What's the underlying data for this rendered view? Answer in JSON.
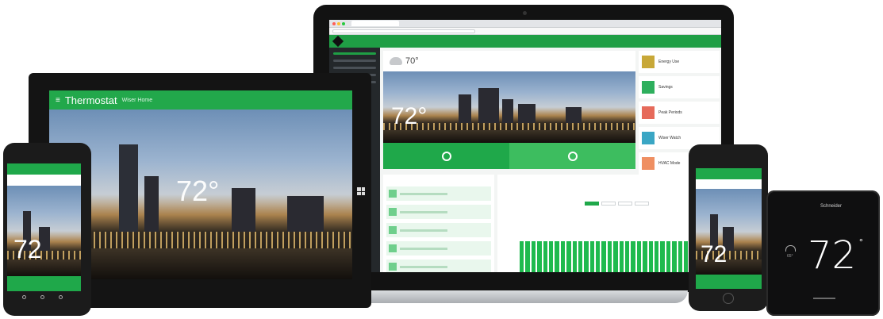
{
  "laptop": {
    "hero_temp": "72°",
    "hero_header_temp": "70°",
    "cards": [
      {
        "title": "Energy Use",
        "color": "#c8a838"
      },
      {
        "title": "Savings",
        "color": "#2eaf5d"
      },
      {
        "title": "Peak Periods",
        "color": "#e66a5a"
      },
      {
        "title": "Wiser Watch",
        "color": "#3aa6c4"
      },
      {
        "title": "HVAC Mode",
        "color": "#ef8f62"
      }
    ],
    "chart": {
      "bar_count": 33
    }
  },
  "tablet": {
    "title": "Thermostat",
    "subtitle": "Wiser Home",
    "temp": "72°"
  },
  "android": {
    "temp": "72"
  },
  "iphone": {
    "temp": "72"
  },
  "wiser_device": {
    "brand": "Schneider",
    "temp": "72",
    "degree": "°",
    "outside_temp": "65°"
  }
}
